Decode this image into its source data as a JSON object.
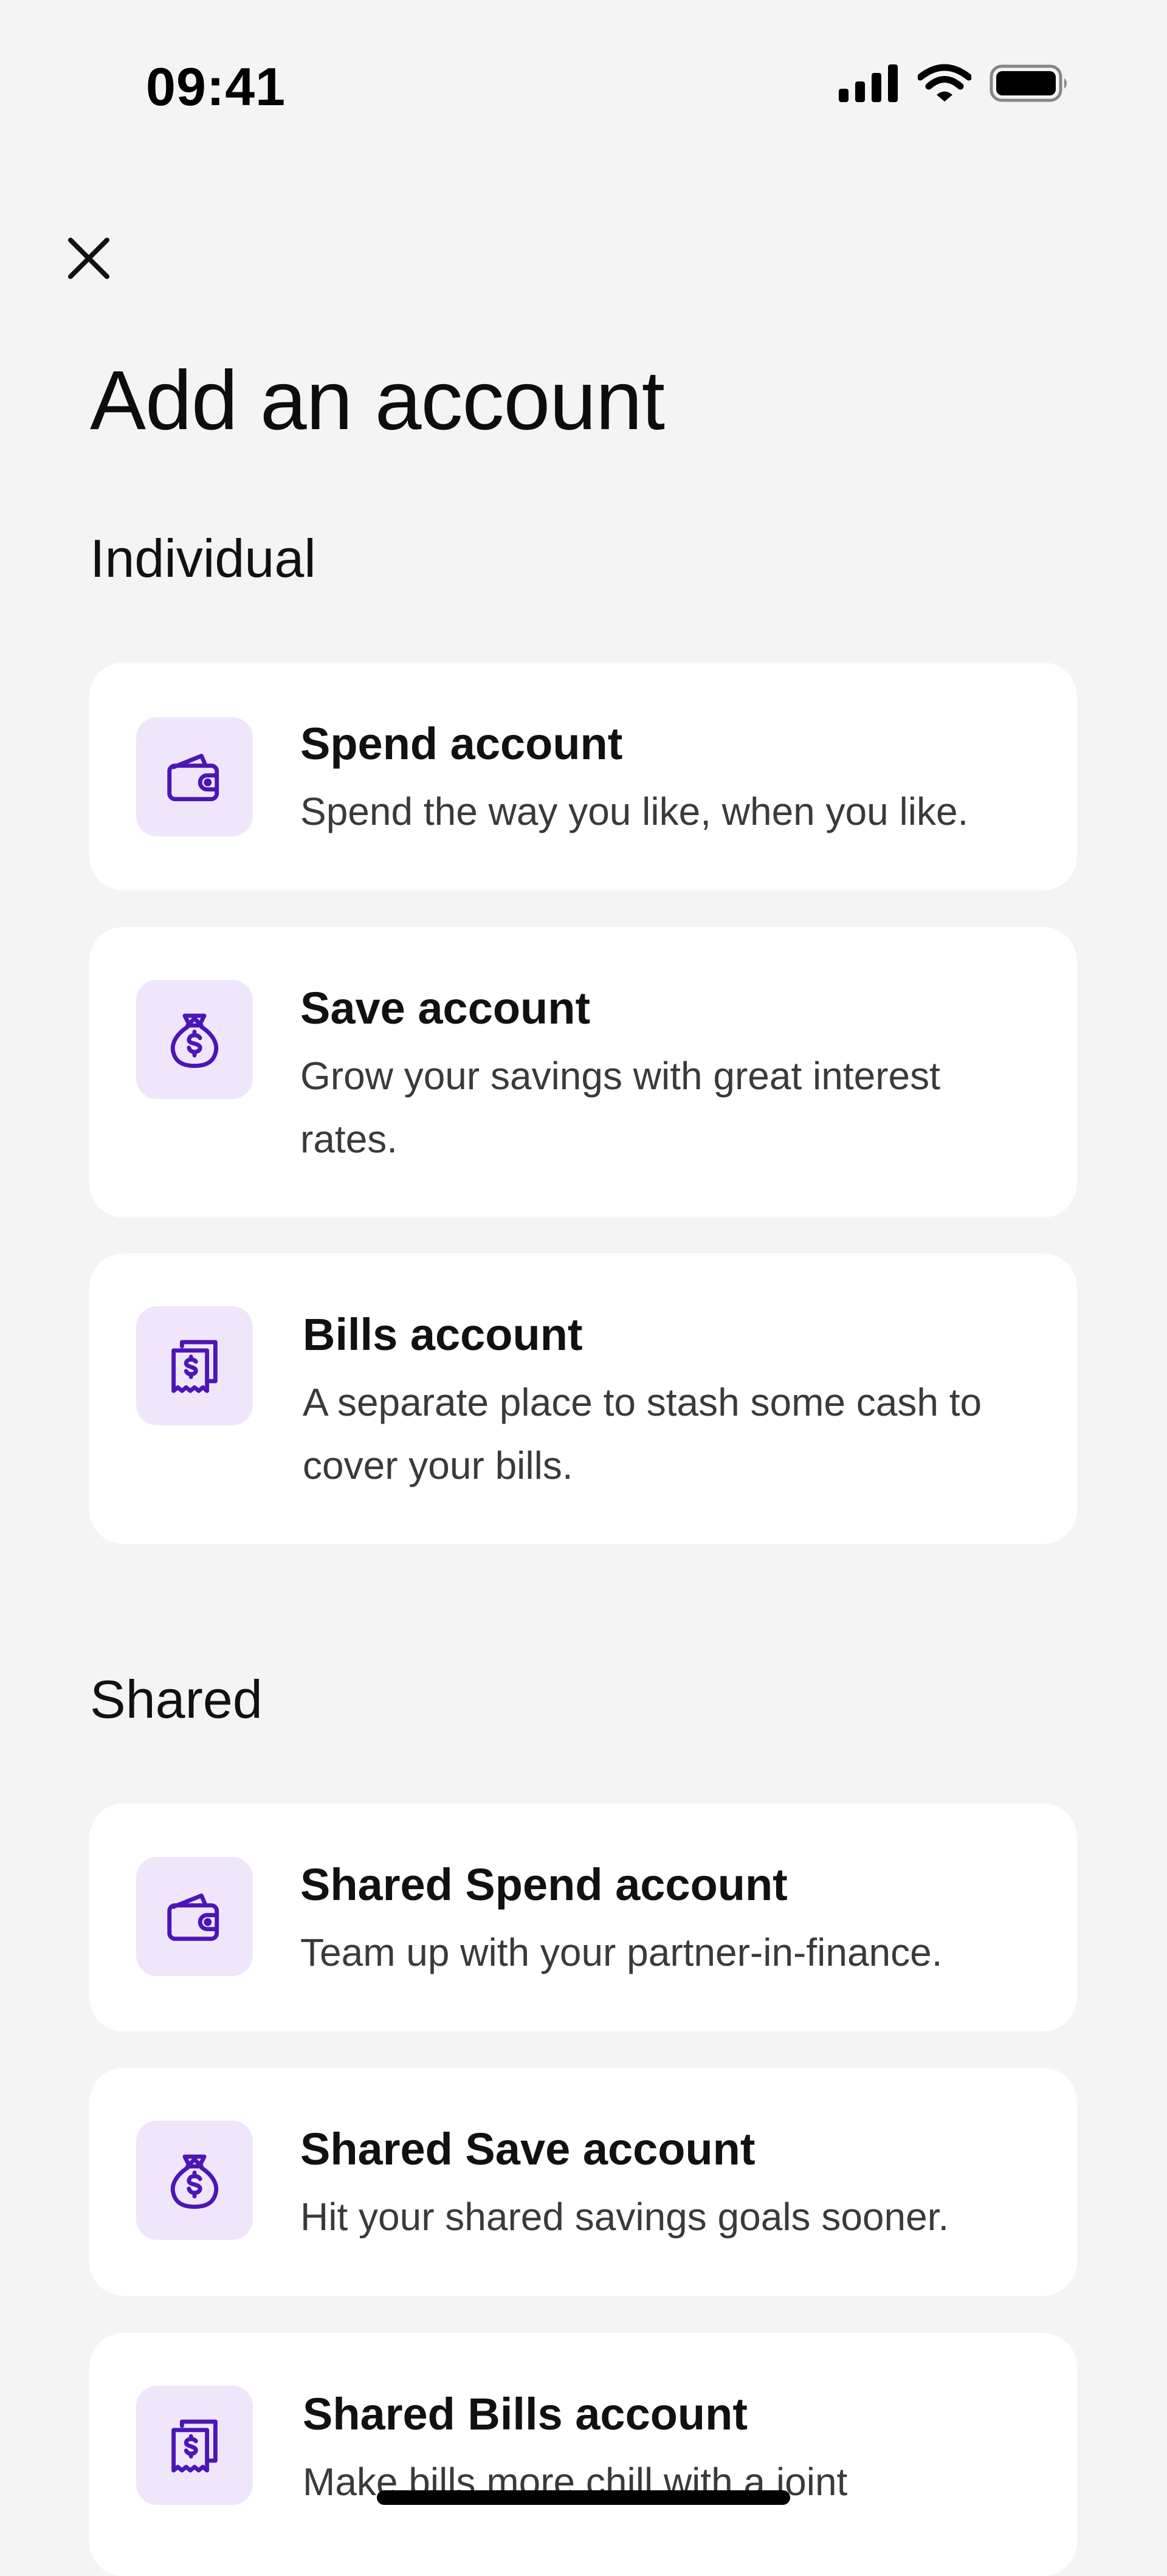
{
  "status_bar": {
    "time": "09:41"
  },
  "header": {
    "close_icon": "close-icon",
    "title": "Add an account"
  },
  "sections": [
    {
      "label": "Individual",
      "cards": [
        {
          "icon": "wallet-icon",
          "title": "Spend account",
          "description": "Spend the way you like, when you like."
        },
        {
          "icon": "money-bag-icon",
          "title": "Save account",
          "description": "Grow your savings with great interest rates."
        },
        {
          "icon": "receipt-icon",
          "title": "Bills account",
          "description": "A separate place to stash some cash to cover your bills."
        }
      ]
    },
    {
      "label": "Shared",
      "cards": [
        {
          "icon": "wallet-icon",
          "title": "Shared Spend account",
          "description": "Team up with your partner-in-finance."
        },
        {
          "icon": "money-bag-icon",
          "title": "Shared Save account",
          "description": "Hit your shared savings goals sooner."
        },
        {
          "icon": "receipt-icon",
          "title": "Shared Bills account",
          "description": "Make bills more chill with a joint"
        }
      ]
    }
  ],
  "colors": {
    "background": "#f4f4f5",
    "card": "#ffffff",
    "icon_tile": "#efe6fc",
    "icon_stroke": "#4b16b6",
    "text_primary": "#111111",
    "text_secondary": "#3a3a3a"
  }
}
